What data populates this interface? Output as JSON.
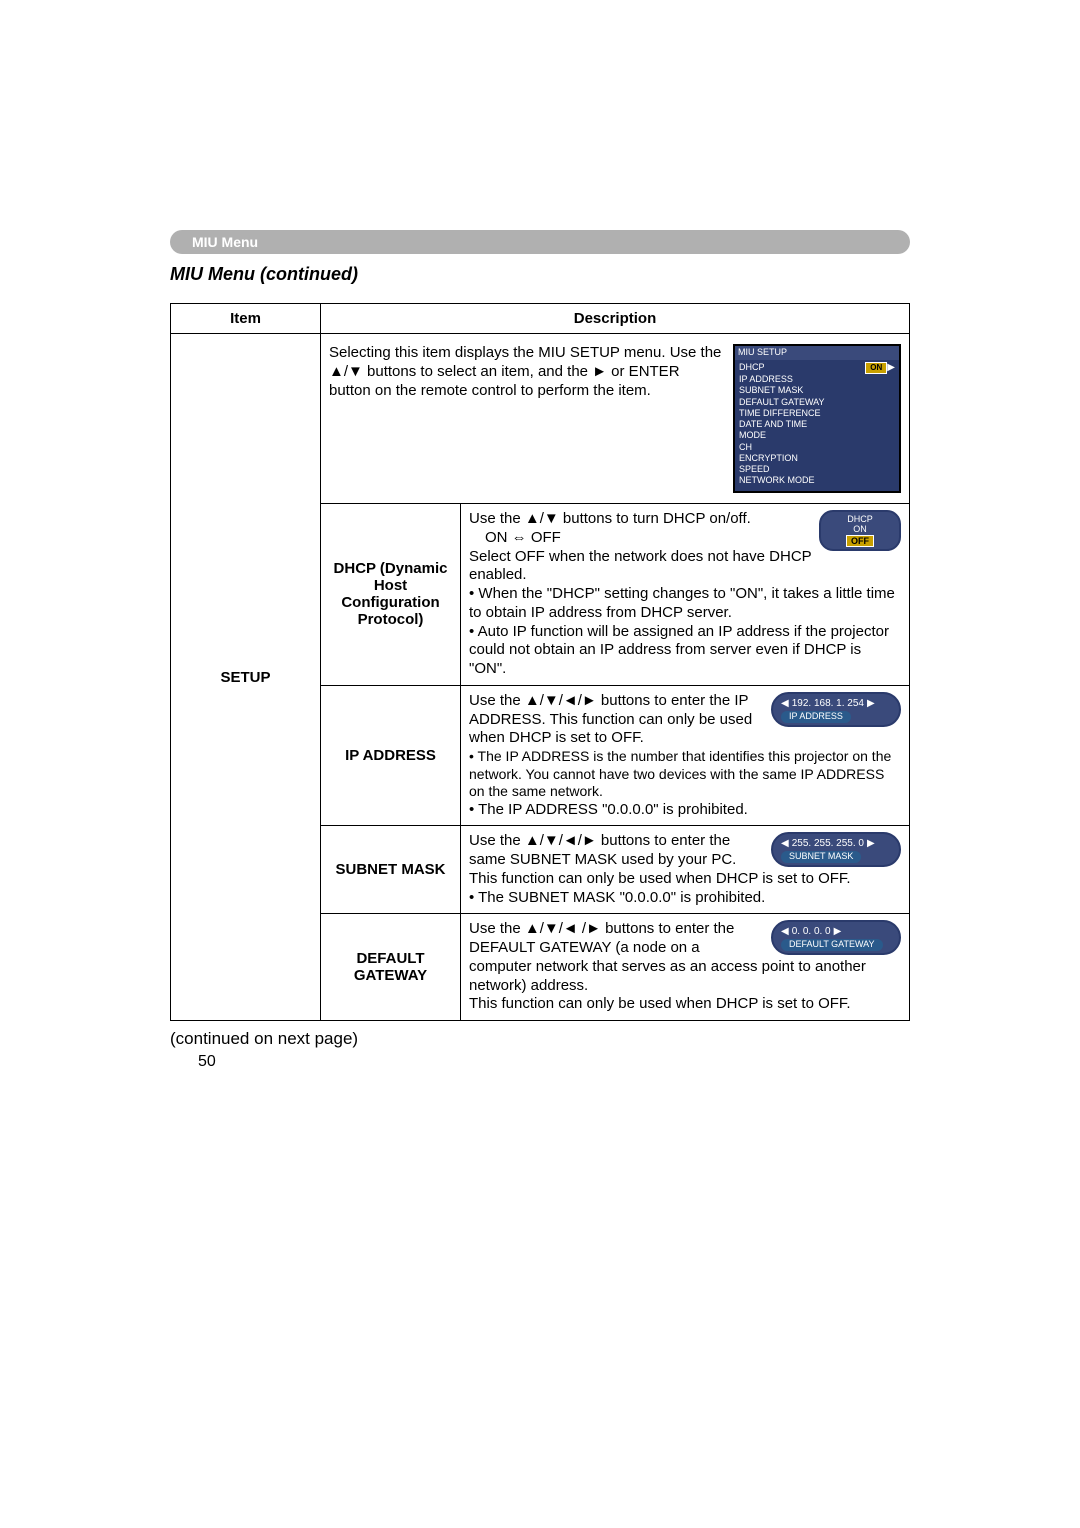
{
  "ribbon": {
    "title": "MIU Menu"
  },
  "section_title": "MIU Menu (continued)",
  "table": {
    "header_item": "Item",
    "header_desc": "Description",
    "item_label": "SETUP",
    "intro_text": "Selecting this item displays the MIU SETUP menu. Use the ▲/▼ buttons to select an item, and the ► or ENTER button on the remote control to perform the item.",
    "menu_panel": {
      "title": "MIU SETUP",
      "row_label": "DHCP",
      "row_value": "ON",
      "items": [
        "IP ADDRESS",
        "SUBNET MASK",
        "DEFAULT GATEWAY",
        "TIME DIFFERENCE",
        "DATE AND TIME",
        "MODE",
        "CH",
        "ENCRYPTION",
        "SPEED",
        "NETWORK MODE"
      ]
    },
    "rows": [
      {
        "sub": "DHCP (Dynamic Host Configuration Protocol)",
        "desc_lines": [
          "Use the ▲/▼ buttons to turn DHCP on/off.",
          "ON ⇔ OFF",
          "Select OFF when the network does not have DHCP enabled.",
          "• When the \"DHCP\" setting changes to \"ON\", it takes a little time to obtain IP address from DHCP server.",
          "• Auto IP function will be assigned an IP address if the projector could not obtain an IP address from server even if DHCP is \"ON\"."
        ],
        "tag": {
          "title": "DHCP",
          "line1": "ON",
          "line2": "OFF"
        }
      },
      {
        "sub": "IP ADDRESS",
        "desc_lines": [
          "Use the ▲/▼/◄/► buttons to enter the IP ADDRESS. This function can only be used when DHCP is set to OFF.",
          "• The IP ADDRESS is the number that identifies this projector on the network. You cannot have two devices with the same IP ADDRESS on the same network.",
          "• The IP ADDRESS \"0.0.0.0\" is prohibited."
        ],
        "img": {
          "values": "192. 168. 1. 254",
          "label": "IP ADDRESS"
        }
      },
      {
        "sub": "SUBNET MASK",
        "desc_lines": [
          "Use the ▲/▼/◄/► buttons to enter the same SUBNET MASK used by your PC. This function can only be used when DHCP is set to OFF.",
          "• The SUBNET MASK \"0.0.0.0\" is prohibited."
        ],
        "img": {
          "values": "255. 255. 255. 0",
          "label": "SUBNET MASK"
        }
      },
      {
        "sub": "DEFAULT GATEWAY",
        "desc_lines": [
          "Use the ▲/▼/◄ /► buttons to enter the DEFAULT GATEWAY (a node on a computer network that serves as an access point to another network) address.",
          "This function can only be used when DHCP is set to OFF."
        ],
        "img": {
          "values": "0. 0. 0. 0",
          "label": "DEFAULT GATEWAY"
        }
      }
    ]
  },
  "footer": "(continued on next page)",
  "page_number": "50"
}
